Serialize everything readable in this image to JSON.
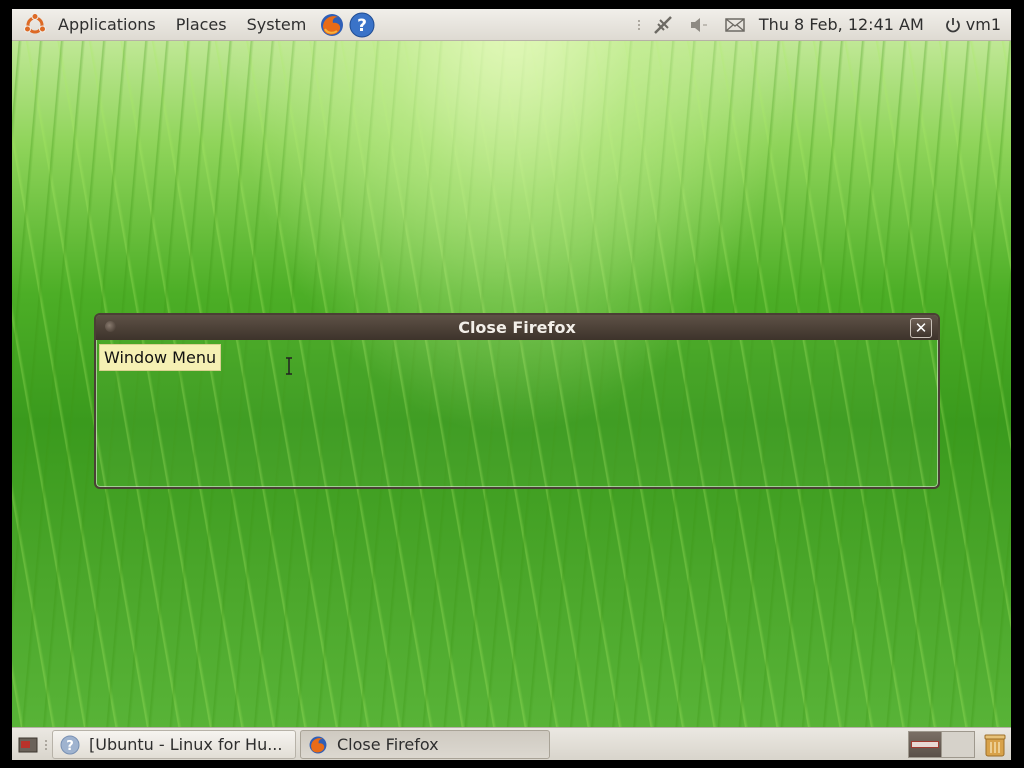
{
  "top_panel": {
    "menus": [
      "Applications",
      "Places",
      "System"
    ],
    "launchers": [
      "firefox-icon",
      "help-icon"
    ],
    "tray_icons": [
      "network-icon",
      "volume-icon",
      "mail-icon"
    ],
    "clock": "Thu  8 Feb, 12:41 AM",
    "user": "vm1"
  },
  "dialog": {
    "title": "Close Firefox",
    "tooltip": "Window Menu",
    "close_glyph": "✕"
  },
  "taskbar": {
    "tasks": [
      {
        "label": "[Ubuntu - Linux for Hu...",
        "icon": "help-icon"
      },
      {
        "label": "Close Firefox",
        "icon": "firefox-icon"
      }
    ]
  },
  "colors": {
    "panel": "#dedad2",
    "titlebar": "#4a3e35",
    "tooltip": "#f5f0b3",
    "desktop_green": "#4cae26"
  }
}
